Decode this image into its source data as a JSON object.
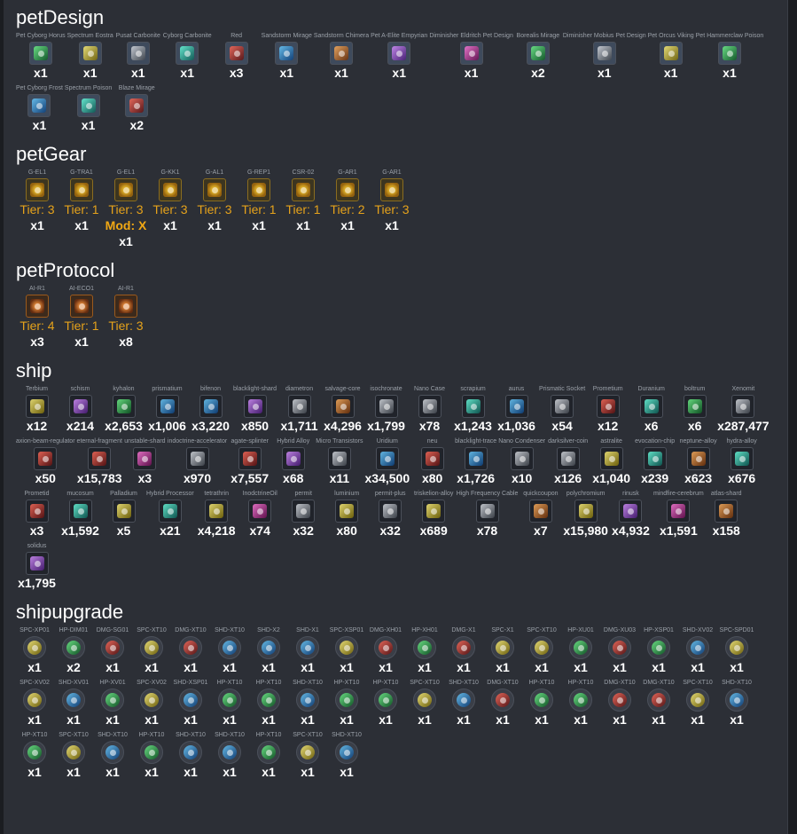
{
  "sections": [
    {
      "title": "petDesign",
      "kind": "pet",
      "items": [
        {
          "name": "Pet Cyborg Horus",
          "qty": "x1",
          "color": "c-green"
        },
        {
          "name": "Spectrum Eostra",
          "qty": "x1",
          "color": "c-yellow"
        },
        {
          "name": "Pusat Carbonite",
          "qty": "x1",
          "color": "c-gray"
        },
        {
          "name": "Cyborg Carbonite",
          "qty": "x1",
          "color": "c-teal"
        },
        {
          "name": "Red",
          "qty": "x3",
          "color": "c-red"
        },
        {
          "name": "Sandstorm Mirage",
          "qty": "x1",
          "color": "c-blue"
        },
        {
          "name": "Sandstorm Chimera",
          "qty": "x1",
          "color": "c-orange"
        },
        {
          "name": "Pet A-Elite Empyrian",
          "qty": "x1",
          "color": "c-purple"
        },
        {
          "name": "Diminisher Eldritch Pet Design",
          "qty": "x1",
          "color": "c-pink"
        },
        {
          "name": "Borealis Mirage",
          "qty": "x2",
          "color": "c-green"
        },
        {
          "name": "Diminisher Mobius Pet Design",
          "qty": "x1",
          "color": "c-gray"
        },
        {
          "name": "Pet Orcus Viking",
          "qty": "x1",
          "color": "c-yellow"
        },
        {
          "name": "Pet Hammerclaw Poison",
          "qty": "x1",
          "color": "c-green"
        },
        {
          "name": "Pet Cyborg Frost",
          "qty": "x1",
          "color": "c-blue"
        },
        {
          "name": "Spectrum Poison",
          "qty": "x1",
          "color": "c-teal"
        },
        {
          "name": "Blaze Mirage",
          "qty": "x2",
          "color": "c-red"
        }
      ]
    },
    {
      "title": "petGear",
      "kind": "gear",
      "items": [
        {
          "name": "G-EL1",
          "tier": "Tier: 3",
          "qty": "x1"
        },
        {
          "name": "G-TRA1",
          "tier": "Tier: 1",
          "qty": "x1"
        },
        {
          "name": "G-EL1",
          "tier": "Tier: 3",
          "mod": "Mod: X",
          "qty": "x1"
        },
        {
          "name": "G-KK1",
          "tier": "Tier: 3",
          "qty": "x1"
        },
        {
          "name": "G-AL1",
          "tier": "Tier: 3",
          "qty": "x1"
        },
        {
          "name": "G-REP1",
          "tier": "Tier: 1",
          "qty": "x1"
        },
        {
          "name": "CSR-02",
          "tier": "Tier: 1",
          "qty": "x1"
        },
        {
          "name": "G-AR1",
          "tier": "Tier: 2",
          "qty": "x1"
        },
        {
          "name": "G-AR1",
          "tier": "Tier: 3",
          "qty": "x1"
        }
      ]
    },
    {
      "title": "petProtocol",
      "kind": "proto",
      "items": [
        {
          "name": "AI-R1",
          "tier": "Tier: 4",
          "qty": "x3"
        },
        {
          "name": "AI-ECO1",
          "tier": "Tier: 1",
          "qty": "x1"
        },
        {
          "name": "AI-R1",
          "tier": "Tier: 3",
          "qty": "x8"
        }
      ]
    },
    {
      "title": "ship",
      "kind": "ship",
      "items": [
        {
          "name": "Terbium",
          "qty": "x12",
          "color": "c-yellow"
        },
        {
          "name": "schism",
          "qty": "x214",
          "color": "c-purple"
        },
        {
          "name": "kyhalon",
          "qty": "x2,653",
          "color": "c-green"
        },
        {
          "name": "prismatium",
          "qty": "x1,006",
          "color": "c-blue"
        },
        {
          "name": "bifenon",
          "qty": "x3,220",
          "color": "c-blue"
        },
        {
          "name": "blacklight-shard",
          "qty": "x850",
          "color": "c-purple"
        },
        {
          "name": "diametron",
          "qty": "x1,711",
          "color": "c-gray"
        },
        {
          "name": "salvage-core",
          "qty": "x4,296",
          "color": "c-orange"
        },
        {
          "name": "isochronate",
          "qty": "x1,799",
          "color": "c-gray"
        },
        {
          "name": "Nano Case",
          "qty": "x78",
          "color": "c-gray"
        },
        {
          "name": "scrapium",
          "qty": "x1,243",
          "color": "c-teal"
        },
        {
          "name": "aurus",
          "qty": "x1,036",
          "color": "c-blue"
        },
        {
          "name": "Prismatic Socket",
          "qty": "x54",
          "color": "c-gray"
        },
        {
          "name": "Prometium",
          "qty": "x12",
          "color": "c-red"
        },
        {
          "name": "Duranium",
          "qty": "x6",
          "color": "c-teal"
        },
        {
          "name": "boltrum",
          "qty": "x6",
          "color": "c-green"
        },
        {
          "name": "Xenomit",
          "qty": "x287,477",
          "color": "c-gray"
        },
        {
          "name": "axion-beam-regulator",
          "qty": "x50",
          "color": "c-red"
        },
        {
          "name": "eternal-fragment",
          "qty": "x15,783",
          "color": "c-red"
        },
        {
          "name": "unstable-shard",
          "qty": "x3",
          "color": "c-pink"
        },
        {
          "name": "indoctrine-accelerator",
          "qty": "x970",
          "color": "c-gray"
        },
        {
          "name": "agate-splinter",
          "qty": "x7,557",
          "color": "c-red"
        },
        {
          "name": "Hybrid Alloy",
          "qty": "x68",
          "color": "c-purple"
        },
        {
          "name": "Micro Transistors",
          "qty": "x11",
          "color": "c-gray"
        },
        {
          "name": "Uridium",
          "qty": "x34,500",
          "color": "c-blue"
        },
        {
          "name": "neu",
          "qty": "x80",
          "color": "c-red"
        },
        {
          "name": "blacklight-trace",
          "qty": "x1,726",
          "color": "c-blue"
        },
        {
          "name": "Nano Condenser",
          "qty": "x10",
          "color": "c-gray"
        },
        {
          "name": "darksilver-coin",
          "qty": "x126",
          "color": "c-gray"
        },
        {
          "name": "astralite",
          "qty": "x1,040",
          "color": "c-yellow"
        },
        {
          "name": "evocation-chip",
          "qty": "x239",
          "color": "c-teal"
        },
        {
          "name": "neptune-alloy",
          "qty": "x623",
          "color": "c-orange"
        },
        {
          "name": "hydra-alloy",
          "qty": "x676",
          "color": "c-teal"
        },
        {
          "name": "Prometid",
          "qty": "x3",
          "color": "c-red"
        },
        {
          "name": "mucosum",
          "qty": "x1,592",
          "color": "c-teal"
        },
        {
          "name": "Palladium",
          "qty": "x5",
          "color": "c-yellow"
        },
        {
          "name": "Hybrid Processor",
          "qty": "x21",
          "color": "c-teal"
        },
        {
          "name": "tetrathrin",
          "qty": "x4,218",
          "color": "c-yellow"
        },
        {
          "name": "InodctrineOil",
          "qty": "x74",
          "color": "c-pink"
        },
        {
          "name": "permit",
          "qty": "x32",
          "color": "c-gray"
        },
        {
          "name": "luminium",
          "qty": "x80",
          "color": "c-yellow"
        },
        {
          "name": "permit-plus",
          "qty": "x32",
          "color": "c-gray"
        },
        {
          "name": "triskelion-alloy",
          "qty": "x689",
          "color": "c-yellow"
        },
        {
          "name": "High Frequency Cable",
          "qty": "x78",
          "color": "c-gray"
        },
        {
          "name": "quickcoupon",
          "qty": "x7",
          "color": "c-orange"
        },
        {
          "name": "polychromium",
          "qty": "x15,980",
          "color": "c-yellow"
        },
        {
          "name": "rinusk",
          "qty": "x4,932",
          "color": "c-purple"
        },
        {
          "name": "mindfire-cerebrum",
          "qty": "x1,591",
          "color": "c-pink"
        },
        {
          "name": "atlas-shard",
          "qty": "x158",
          "color": "c-orange"
        },
        {
          "name": "solidus",
          "qty": "x1,795",
          "color": "c-purple"
        }
      ]
    },
    {
      "title": "shipupgrade",
      "kind": "up",
      "items": [
        {
          "name": "SPC-XP01",
          "qty": "x1",
          "color": "c-yellow"
        },
        {
          "name": "HP-DIM01",
          "qty": "x2",
          "color": "c-green"
        },
        {
          "name": "DMG-SG01",
          "qty": "x1",
          "color": "c-red"
        },
        {
          "name": "SPC-XT10",
          "qty": "x1",
          "color": "c-yellow"
        },
        {
          "name": "DMG-XT10",
          "qty": "x1",
          "color": "c-red"
        },
        {
          "name": "SHD-XT10",
          "qty": "x1",
          "color": "c-blue"
        },
        {
          "name": "SHD-X2",
          "qty": "x1",
          "color": "c-blue"
        },
        {
          "name": "SHD-X1",
          "qty": "x1",
          "color": "c-blue"
        },
        {
          "name": "SPC-XSP01",
          "qty": "x1",
          "color": "c-yellow"
        },
        {
          "name": "DMG-XH01",
          "qty": "x1",
          "color": "c-red"
        },
        {
          "name": "HP-XH01",
          "qty": "x1",
          "color": "c-green"
        },
        {
          "name": "DMG-X1",
          "qty": "x1",
          "color": "c-red"
        },
        {
          "name": "SPC-X1",
          "qty": "x1",
          "color": "c-yellow"
        },
        {
          "name": "SPC-XT10",
          "qty": "x1",
          "color": "c-yellow"
        },
        {
          "name": "HP-XU01",
          "qty": "x1",
          "color": "c-green"
        },
        {
          "name": "DMG-XU03",
          "qty": "x1",
          "color": "c-red"
        },
        {
          "name": "HP-XSP01",
          "qty": "x1",
          "color": "c-green"
        },
        {
          "name": "SHD-XV02",
          "qty": "x1",
          "color": "c-blue"
        },
        {
          "name": "SPC-SPD01",
          "qty": "x1",
          "color": "c-yellow"
        },
        {
          "name": "SPC-XV02",
          "qty": "x1",
          "color": "c-yellow"
        },
        {
          "name": "SHD-XV01",
          "qty": "x1",
          "color": "c-blue"
        },
        {
          "name": "HP-XV01",
          "qty": "x1",
          "color": "c-green"
        },
        {
          "name": "SPC-XV02",
          "qty": "x1",
          "color": "c-yellow"
        },
        {
          "name": "SHD-XSP01",
          "qty": "x1",
          "color": "c-blue"
        },
        {
          "name": "HP-XT10",
          "qty": "x1",
          "color": "c-green"
        },
        {
          "name": "HP-XT10",
          "qty": "x1",
          "color": "c-green"
        },
        {
          "name": "SHD-XT10",
          "qty": "x1",
          "color": "c-blue"
        },
        {
          "name": "HP-XT10",
          "qty": "x1",
          "color": "c-green"
        },
        {
          "name": "HP-XT10",
          "qty": "x1",
          "color": "c-green"
        },
        {
          "name": "SPC-XT10",
          "qty": "x1",
          "color": "c-yellow"
        },
        {
          "name": "SHD-XT10",
          "qty": "x1",
          "color": "c-blue"
        },
        {
          "name": "DMG-XT10",
          "qty": "x1",
          "color": "c-red"
        },
        {
          "name": "HP-XT10",
          "qty": "x1",
          "color": "c-green"
        },
        {
          "name": "HP-XT10",
          "qty": "x1",
          "color": "c-green"
        },
        {
          "name": "DMG-XT10",
          "qty": "x1",
          "color": "c-red"
        },
        {
          "name": "DMG-XT10",
          "qty": "x1",
          "color": "c-red"
        },
        {
          "name": "SPC-XT10",
          "qty": "x1",
          "color": "c-yellow"
        },
        {
          "name": "SHD-XT10",
          "qty": "x1",
          "color": "c-blue"
        },
        {
          "name": "HP-XT10",
          "qty": "x1",
          "color": "c-green"
        },
        {
          "name": "SPC-XT10",
          "qty": "x1",
          "color": "c-yellow"
        },
        {
          "name": "SHD-XT10",
          "qty": "x1",
          "color": "c-blue"
        },
        {
          "name": "HP-XT10",
          "qty": "x1",
          "color": "c-green"
        },
        {
          "name": "SHD-XT10",
          "qty": "x1",
          "color": "c-blue"
        },
        {
          "name": "SHD-XT10",
          "qty": "x1",
          "color": "c-blue"
        },
        {
          "name": "HP-XT10",
          "qty": "x1",
          "color": "c-green"
        },
        {
          "name": "SPC-XT10",
          "qty": "x1",
          "color": "c-yellow"
        },
        {
          "name": "SHD-XT10",
          "qty": "x1",
          "color": "c-blue"
        }
      ]
    }
  ]
}
